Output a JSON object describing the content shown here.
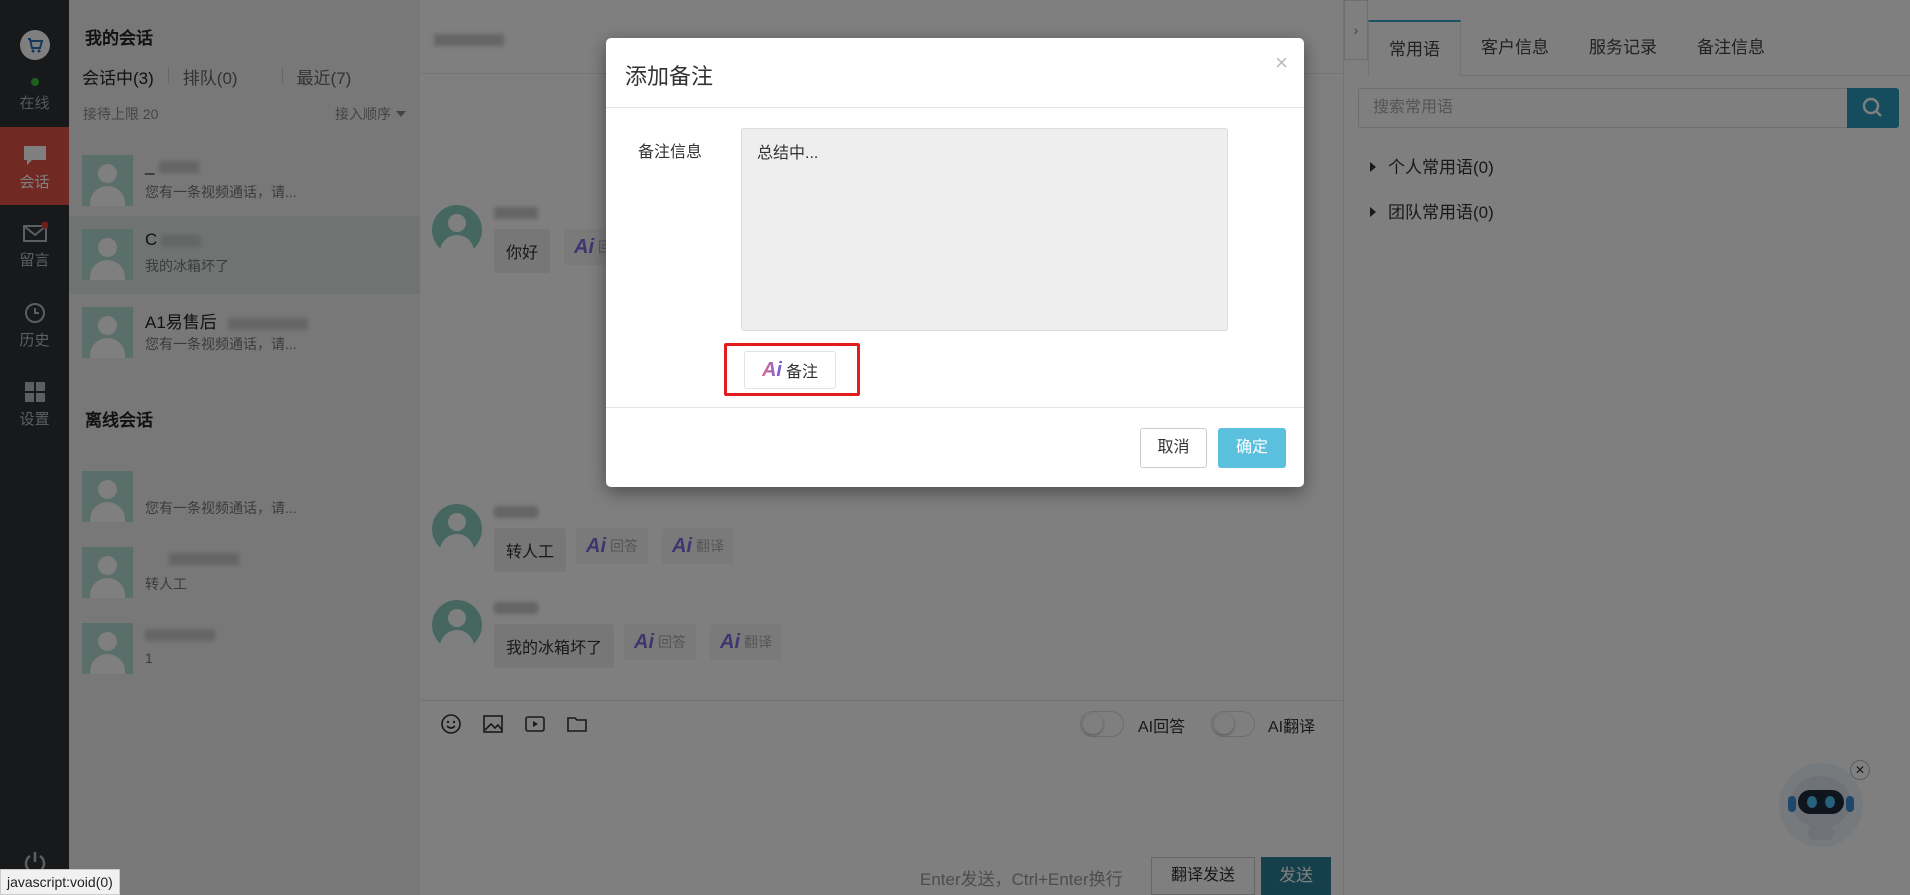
{
  "nav": {
    "status_label": "在线",
    "items": [
      {
        "label": "会话",
        "icon": "chat-icon",
        "active": true
      },
      {
        "label": "留言",
        "icon": "mail-icon",
        "active": false
      },
      {
        "label": "历史",
        "icon": "clock-icon",
        "active": false
      },
      {
        "label": "设置",
        "icon": "grid-icon",
        "active": false
      }
    ],
    "accent_color": "#e25546"
  },
  "conversations": {
    "title": "我的会话",
    "tabs": [
      "会话中(3)",
      "排队(0)",
      "最近(7)"
    ],
    "limit_label": "接待上限 20",
    "order_label": "接入顺序",
    "active": [
      {
        "name": "_",
        "preview": "您有一条视频通话，请..."
      },
      {
        "name": "C",
        "preview": "我的冰箱坏了"
      },
      {
        "name": "A1易售后",
        "preview": "您有一条视频通话，请..."
      }
    ],
    "offline_title": "离线会话",
    "offline": [
      {
        "name": "",
        "preview": "您有一条视频通话，请..."
      },
      {
        "name": "",
        "preview": "转人工"
      },
      {
        "name": "",
        "preview": "1"
      }
    ]
  },
  "chat": {
    "messages": [
      {
        "text": "你好"
      },
      {
        "text": "转人工"
      },
      {
        "text": "我的冰箱坏了"
      }
    ],
    "ai_answer_label": "回答",
    "ai_translate_label": "翻译",
    "ai_mark": "Ai",
    "toggle_ai_answer": "AI回答",
    "toggle_ai_translate": "AI翻译",
    "hint": "Enter发送，Ctrl+Enter换行",
    "translate_send": "翻译发送",
    "send": "发送"
  },
  "right_panel": {
    "tabs": [
      "常用语",
      "客户信息",
      "服务记录",
      "备注信息"
    ],
    "search_placeholder": "搜索常用语",
    "groups": [
      "个人常用语(0)",
      "团队常用语(0)"
    ]
  },
  "modal": {
    "title": "添加备注",
    "close_symbol": "×",
    "field_label": "备注信息",
    "field_value": "总结中...",
    "ai_button_mark": "Ai",
    "ai_button_label": "备注",
    "cancel": "取消",
    "ok": "确定",
    "highlight_color": "#e31b1b",
    "ok_color": "#5bc0de"
  },
  "statusbar": {
    "text": "javascript:void(0)"
  }
}
